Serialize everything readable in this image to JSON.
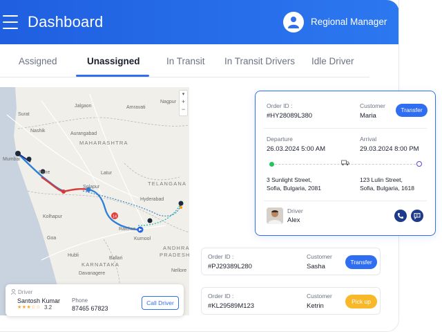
{
  "header": {
    "title": "Dashboard",
    "role": "Regional Manager"
  },
  "tabs": [
    {
      "label": "Assigned"
    },
    {
      "label": "Unassigned"
    },
    {
      "label": "In Transit"
    },
    {
      "label": "In Transit Drivers"
    },
    {
      "label": "Idle Driver"
    }
  ],
  "active_tab": "Unassigned",
  "map": {
    "labels": [
      "Jalgaon",
      "Amravati",
      "Nagpur",
      "Surat",
      "Nashik",
      "MAHARASHTRA",
      "Aurangabad",
      "Mumbai",
      "Pune",
      "Latur",
      "Solapur",
      "TELANGANA",
      "Hyderabad",
      "Kolhapur",
      "Raichur",
      "Kurnool",
      "Goa",
      "Hubli",
      "ANDHRA",
      "PRADESH",
      "KARNATAKA",
      "Ballari",
      "Davanagere",
      "Nellore"
    ],
    "markers": [
      "14"
    ],
    "zoom_in": "+",
    "zoom_out": "−"
  },
  "driver_card": {
    "label": "Driver",
    "name": "Santosh Kumar",
    "stars": "★★★☆☆",
    "rating": "3.2",
    "phone_label": "Phone",
    "phone": "87465 67823",
    "call_button": "Call Driver"
  },
  "main_order": {
    "order_id_label": "Order ID :",
    "order_id": "#HY28089L380",
    "customer_label": "Customer",
    "customer": "Maria",
    "action": "Transfer",
    "departure_label": "Departure",
    "departure_time": "26.03.2024 5:00 AM",
    "arrival_label": "Arrival",
    "arrival_time": "29.03.2024 8:00 PM",
    "origin_line1": "3 Sunlight Street,",
    "origin_line2": "Sofia, Bulgaria, 2081",
    "dest_line1": "123 Lulin Street,",
    "dest_line2": "Sofia, Bulgaria, 1618",
    "driver_label": "Driver",
    "driver_name": "Alex"
  },
  "orders": [
    {
      "order_id_label": "Order ID :",
      "order_id": "#PJ29389L280",
      "customer_label": "Customer",
      "customer": "Sasha",
      "action": "Transfer",
      "action_color": "#2f6ef0"
    },
    {
      "order_id_label": "Order ID :",
      "order_id": "#KL29589M123",
      "customer_label": "Customer",
      "customer": "Ketrin",
      "action": "Pick up",
      "action_color": "#f8b82a"
    }
  ]
}
